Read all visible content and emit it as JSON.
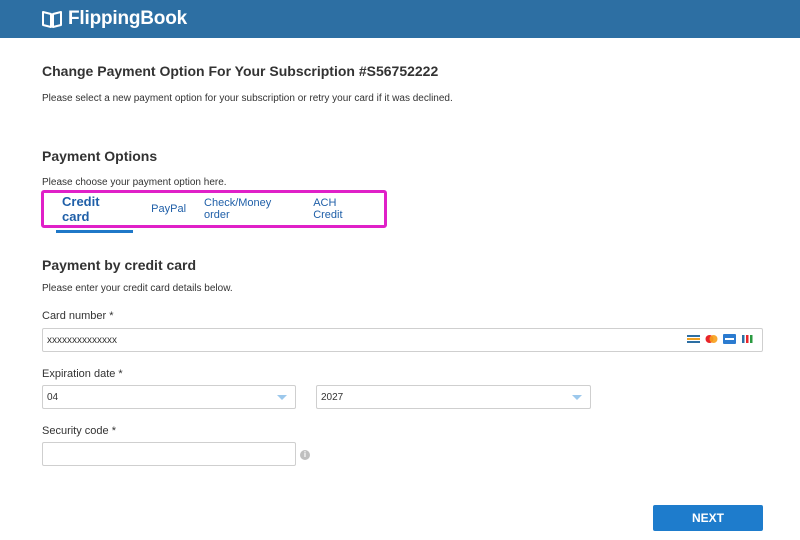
{
  "header": {
    "logo_text": "FlippingBook",
    "logo_icon": "book-icon",
    "background": "#2d6fa3"
  },
  "page": {
    "title": "Change Payment Option For Your Subscription #S56752222",
    "subtitle": "Please select a new payment option for your subscription or retry your card if it was declined."
  },
  "payment_options": {
    "title": "Payment Options",
    "subtitle": "Please choose your payment option here.",
    "tabs": [
      {
        "label": "Credit card",
        "active": true
      },
      {
        "label": "PayPal",
        "active": false
      },
      {
        "label": "Check/Money order",
        "active": false
      },
      {
        "label": "ACH Credit",
        "active": false
      }
    ]
  },
  "credit_card": {
    "title": "Payment by credit card",
    "subtitle": "Please enter your credit card details below.",
    "card_number_label": "Card number *",
    "card_number_value": "xxxxxxxxxxxxxx",
    "card_icons": [
      "card-icon",
      "mastercard-icon",
      "amex-icon",
      "card-stripes-icon"
    ],
    "expiration_label": "Expiration date *",
    "expiration_month": "04",
    "expiration_year": "2027",
    "security_label": "Security code *",
    "security_value": ""
  },
  "actions": {
    "next_label": "NEXT"
  },
  "colors": {
    "accent": "#1e7ccc",
    "highlight": "#e020c8",
    "link": "#1f5fa8"
  }
}
